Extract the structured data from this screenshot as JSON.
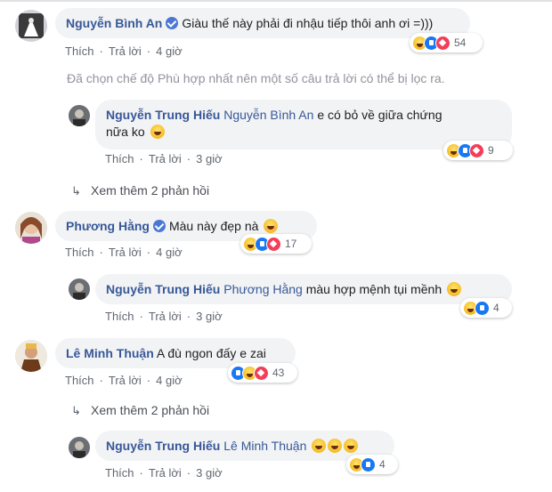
{
  "comments": [
    {
      "author": "Nguyễn Bình An",
      "text": "Giàu thế này phải đi nhậu tiếp thôi anh ơi =)))",
      "like": "Thích",
      "reply": "Trả lời",
      "time": "4 giờ",
      "reactions": [
        "haha",
        "like",
        "love"
      ],
      "count": "54"
    },
    {
      "author": "Nguyễn Trung Hiếu",
      "tag": "Nguyễn Bình An",
      "text_line1": "e có bỏ về giữa chứng",
      "text_line2": "nữa ko",
      "like": "Thích",
      "reply": "Trả lời",
      "time": "3 giờ",
      "reactions": [
        "haha",
        "like",
        "love"
      ],
      "count": "9"
    },
    {
      "author": "Phương Hằng",
      "text": "Màu này đẹp nà",
      "like": "Thích",
      "reply": "Trả lời",
      "time": "4 giờ",
      "reactions": [
        "haha",
        "like",
        "love"
      ],
      "count": "17"
    },
    {
      "author": "Nguyễn Trung Hiếu",
      "tag": "Phương Hằng",
      "text": "màu hợp mệnh tụi mềnh",
      "like": "Thích",
      "reply": "Trả lời",
      "time": "3 giờ",
      "reactions": [
        "haha",
        "like"
      ],
      "count": "4"
    },
    {
      "author": "Lê Minh Thuận",
      "text": "A đù ngon đấy e zai",
      "like": "Thích",
      "reply": "Trả lời",
      "time": "4 giờ",
      "reactions": [
        "like",
        "haha",
        "love"
      ],
      "count": "43"
    },
    {
      "author": "Nguyễn Trung Hiếu",
      "tag": "Lê Minh Thuận",
      "like": "Thích",
      "reply": "Trả lời",
      "time": "3 giờ",
      "reactions": [
        "haha",
        "like"
      ],
      "count": "4"
    }
  ],
  "notice": "Đã chọn chế độ Phù hợp nhất nên một số câu trả lời có thể bị lọc ra.",
  "more_replies_1": "Xem thêm 2 phản hồi",
  "more_replies_2": "Xem thêm 2 phản hồi",
  "colors": {
    "link": "#385898",
    "meta": "#616770",
    "bubble": "#f2f3f5",
    "like": "#1877f2",
    "love": "#f33e58",
    "haha": "#f5b921"
  }
}
